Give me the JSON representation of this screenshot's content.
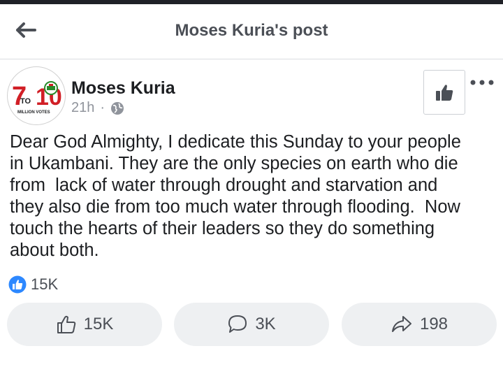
{
  "header": {
    "title": "Moses Kuria's post",
    "back_icon": "arrow-left-icon"
  },
  "post": {
    "author": "Moses Kuria",
    "time": "21h",
    "separator": "·",
    "privacy_icon": "globe-icon",
    "avatar": {
      "big_number_left": "7",
      "big_number_right": "10",
      "to_label": "TO",
      "tagline": "MILLION VOTES"
    },
    "body": "Dear God Almighty, I dedicate this Sunday to your people\nin Ukambani. They are the only species on earth who die\nfrom  lack of water through drought and starvation and\nthey also die from too much water through flooding.  Now\ntouch the hearts of their leaders so they do something\nabout both."
  },
  "reactions": {
    "count": "15K",
    "icon": "like-reaction-icon",
    "color": "#2d88ff"
  },
  "actions": {
    "like": {
      "label": "15K",
      "icon": "thumbs-up-outline-icon"
    },
    "comment": {
      "label": "3K",
      "icon": "comment-bubble-icon"
    },
    "share": {
      "label": "198",
      "icon": "share-arrow-icon"
    }
  },
  "colors": {
    "text": "#1c1e21",
    "muted": "#90949c",
    "button_bg": "#eef0f2",
    "logo_red": "#d11f26",
    "logo_green": "#2a8a2a"
  }
}
